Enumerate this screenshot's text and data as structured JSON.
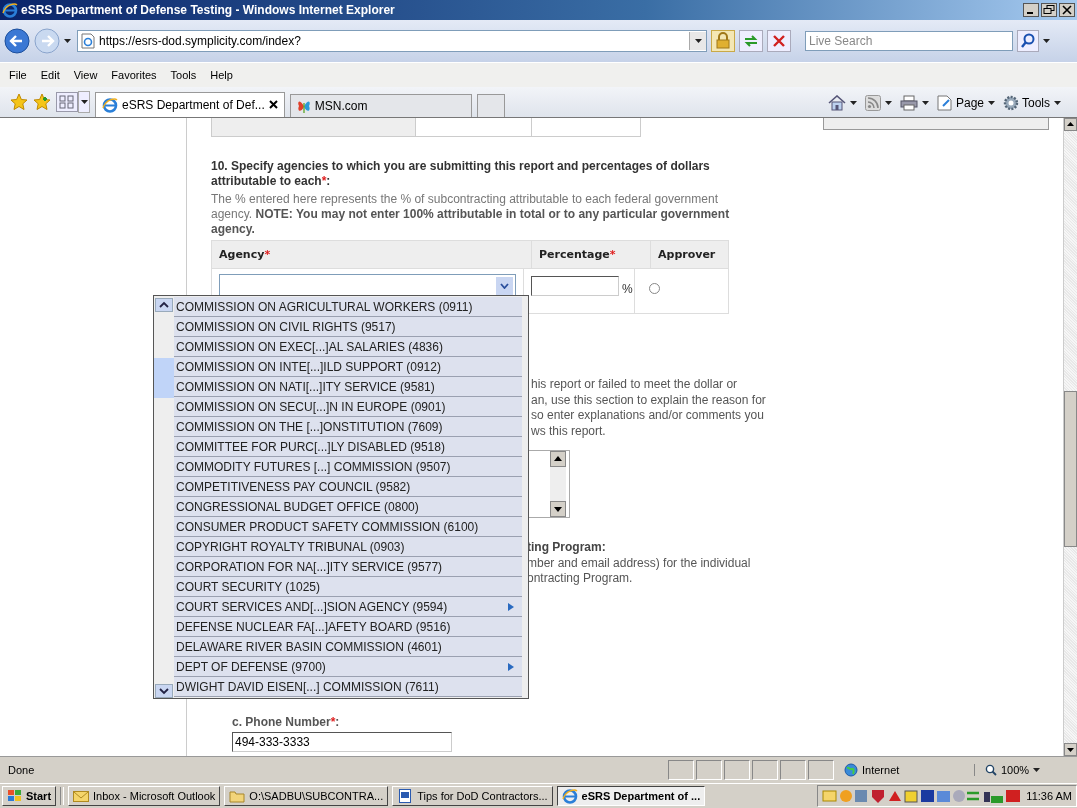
{
  "window": {
    "title": "eSRS Department of Defense Testing - Windows Internet Explorer"
  },
  "address_bar": {
    "url": "https://esrs-dod.symplicity.com/index?",
    "search_placeholder": "Live Search"
  },
  "menu": [
    "File",
    "Edit",
    "View",
    "Favorites",
    "Tools",
    "Help"
  ],
  "tabs": [
    {
      "label": "eSRS Department of Def...",
      "selected": true,
      "closable": true
    },
    {
      "label": "MSN.com",
      "selected": false,
      "closable": false
    }
  ],
  "command_bar": [
    {
      "kind": "home"
    },
    {
      "kind": "feeds"
    },
    {
      "kind": "print"
    },
    {
      "kind": "page",
      "label": "Page"
    },
    {
      "kind": "tools",
      "label": "Tools"
    }
  ],
  "form": {
    "question": {
      "text": "10. Specify agencies to which you are submitting this report and percentages of dollars attributable to each",
      "required_mark": "*",
      "suffix": ":"
    },
    "help": "The % entered here represents the % of subcontracting attributable to each federal government agency. **NOTE: You may not enter 100% attributable in total or to any particular government agency.**",
    "table": {
      "columns": [
        {
          "label": "Agency",
          "required_mark": "*"
        },
        {
          "label": "Percentage",
          "required_mark": "*"
        },
        {
          "label": "Approver"
        }
      ],
      "row": {
        "percent_sign": "%",
        "approver_selected": false
      }
    },
    "dropdown": {
      "open": true,
      "items": [
        {
          "label": "COMMISSION ON AGRICULTURAL WORKERS (0911)",
          "has_submenu": false
        },
        {
          "label": "COMMISSION ON CIVIL RIGHTS (9517)",
          "has_submenu": false
        },
        {
          "label": "COMMISSION ON EXEC[...]AL SALARIES (4836)",
          "has_submenu": false
        },
        {
          "label": "COMMISSION ON INTE[...]ILD SUPPORT (0912)",
          "has_submenu": false
        },
        {
          "label": "COMMISSION ON NATI[...]ITY SERVICE (9581)",
          "has_submenu": false
        },
        {
          "label": "COMMISSION ON SECU[...]N IN EUROPE (0901)",
          "has_submenu": false
        },
        {
          "label": "COMMISSION ON THE [...]ONSTITUTION (7609)",
          "has_submenu": false
        },
        {
          "label": "COMMITTEE FOR PURC[...]LY DISABLED (9518)",
          "has_submenu": false
        },
        {
          "label": "COMMODITY FUTURES [...] COMMISSION (9507)",
          "has_submenu": false
        },
        {
          "label": "COMPETITIVENESS PAY COUNCIL (9582)",
          "has_submenu": false
        },
        {
          "label": "CONGRESSIONAL BUDGET OFFICE (0800)",
          "has_submenu": false
        },
        {
          "label": "CONSUMER PRODUCT SAFETY COMMISSION (6100)",
          "has_submenu": false
        },
        {
          "label": "COPYRIGHT ROYALTY TRIBUNAL (0903)",
          "has_submenu": false
        },
        {
          "label": "CORPORATION FOR NA[...]ITY SERVICE (9577)",
          "has_submenu": false
        },
        {
          "label": "COURT SECURITY (1025)",
          "has_submenu": false
        },
        {
          "label": "COURT SERVICES AND[...]SION AGENCY (9594)",
          "has_submenu": true
        },
        {
          "label": "DEFENSE NUCLEAR FA[...]AFETY BOARD (9516)",
          "has_submenu": false
        },
        {
          "label": "DELAWARE RIVER BASIN COMMISSION (4601)",
          "has_submenu": false
        },
        {
          "label": "DEPT OF DEFENSE (9700)",
          "has_submenu": true
        },
        {
          "label": "DWIGHT DAVID EISEN[...] COMMISSION (7611)",
          "has_submenu": false
        }
      ]
    },
    "explanation_lines": [
      "his report or failed to meet the dollar or",
      "an, use this section to explain the reason for",
      "so enter explanations and/or comments you",
      "ws this report."
    ],
    "contact_heading": "ting Program:",
    "contact_lines": [
      "mber and email address) for the individual",
      "ontracting Program."
    ],
    "phone": {
      "label": "c. Phone Number",
      "required_mark": "*",
      "suffix": ":",
      "value": "494-333-3333"
    }
  },
  "status_bar": {
    "text": "Done",
    "zone": "Internet",
    "zoom": "100%"
  },
  "taskbar": {
    "start": "Start",
    "tasks": [
      {
        "label": "Inbox - Microsoft Outlook",
        "kind": "mail",
        "selected": false
      },
      {
        "label": "O:\\SADBU\\SUBCONTRA...",
        "kind": "folder",
        "selected": false
      },
      {
        "label": "Tips for DoD Contractors...",
        "kind": "document",
        "selected": false
      },
      {
        "label": "eSRS Department of ...",
        "kind": "browser",
        "selected": true
      }
    ],
    "clock": "11:36 AM"
  }
}
